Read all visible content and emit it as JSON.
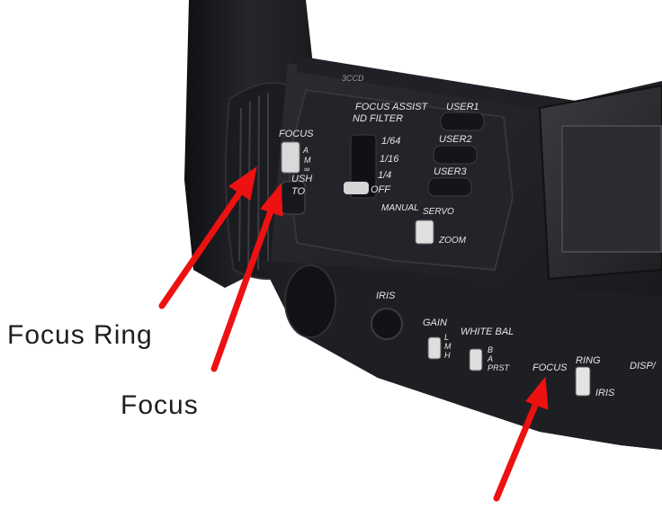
{
  "annotations": {
    "focus_ring": "Focus Ring",
    "focus": "Focus"
  },
  "camera_markings": {
    "brand_mark": "3CCD",
    "focus_assist_1": "FOCUS ASSIST",
    "focus_assist_2": "ND FILTER",
    "focus_switch": "FOCUS",
    "focus_a": "A",
    "focus_m": "M",
    "focus_inf": "∞",
    "push_1": "USH",
    "push_2": "TO",
    "nd_1_64": "1/64",
    "nd_1_16": "1/16",
    "nd_1_4": "1/4",
    "nd_off": "OFF",
    "user1": "USER1",
    "user2": "USER2",
    "user3": "USER3",
    "manual": "MANUAL",
    "servo": "SERVO",
    "zoom": "ZOOM",
    "iris_button": "IRIS",
    "gain": "GAIN",
    "gain_l": "L",
    "gain_m": "M",
    "gain_h": "H",
    "white_bal": "WHITE BAL",
    "wb_b": "B",
    "wb_a": "A",
    "wb_prst": "PRST",
    "ring_focus": "FOCUS",
    "ring": "RING",
    "ring_iris": "IRIS",
    "disp": "DISP/"
  },
  "colors": {
    "arrow": "#ee1111",
    "body_dark": "#1c1d20",
    "body_mid": "#2a2b30",
    "marking": "#e6e6e6"
  }
}
